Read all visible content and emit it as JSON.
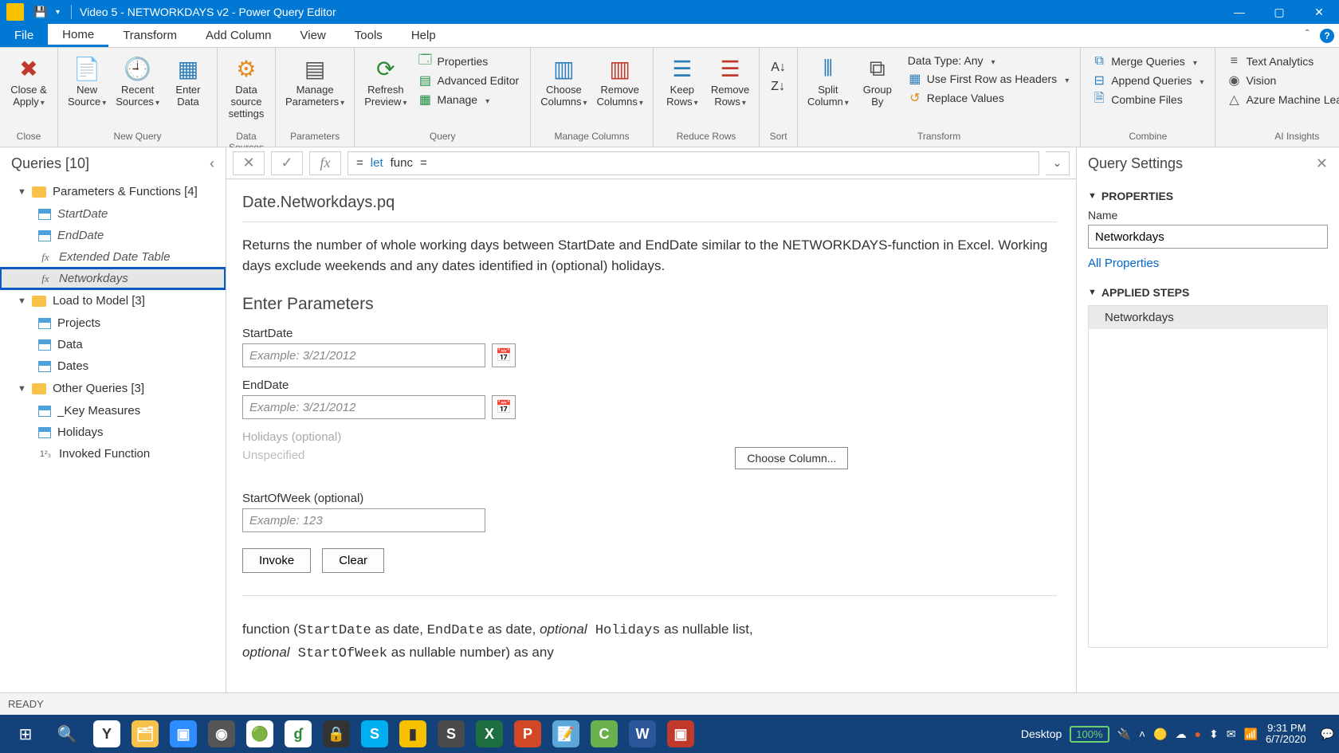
{
  "titlebar": {
    "title": "Video 5 - NETWORKDAYS v2 - Power Query Editor"
  },
  "menu": {
    "file": "File",
    "tabs": [
      "Home",
      "Transform",
      "Add Column",
      "View",
      "Tools",
      "Help"
    ],
    "active": 0
  },
  "ribbon": {
    "close": {
      "label": "Close &\nApply",
      "group": "Close"
    },
    "newquery": {
      "new_source": "New\nSource",
      "recent": "Recent\nSources",
      "enter": "Enter\nData",
      "group": "New Query"
    },
    "datasources": {
      "settings": "Data source\nsettings",
      "group": "Data Sources"
    },
    "parameters": {
      "manage": "Manage\nParameters",
      "group": "Parameters"
    },
    "query": {
      "refresh": "Refresh\nPreview",
      "properties": "Properties",
      "adv": "Advanced Editor",
      "manage": "Manage",
      "group": "Query"
    },
    "managecols": {
      "choose": "Choose\nColumns",
      "remove": "Remove\nColumns",
      "group": "Manage Columns"
    },
    "reducerows": {
      "keep": "Keep\nRows",
      "remove": "Remove\nRows",
      "group": "Reduce Rows"
    },
    "sort": {
      "group": "Sort"
    },
    "transform": {
      "split": "Split\nColumn",
      "group_by": "Group\nBy",
      "datatype": "Data Type: Any",
      "firstrow": "Use First Row as Headers",
      "replace": "Replace Values",
      "group": "Transform"
    },
    "combine": {
      "merge": "Merge Queries",
      "append": "Append Queries",
      "combine": "Combine Files",
      "group": "Combine"
    },
    "ai": {
      "text": "Text Analytics",
      "vision": "Vision",
      "aml": "Azure Machine Learning",
      "group": "AI Insights"
    }
  },
  "queries": {
    "header": "Queries [10]",
    "folders": [
      {
        "name": "Parameters & Functions [4]",
        "items": [
          {
            "label": "StartDate",
            "icon": "table",
            "italic": true
          },
          {
            "label": "EndDate",
            "icon": "table",
            "italic": true
          },
          {
            "label": "Extended Date Table",
            "icon": "fx",
            "italic": true
          },
          {
            "label": "Networkdays",
            "icon": "fx",
            "italic": true,
            "selected": true,
            "highlight": true
          }
        ]
      },
      {
        "name": "Load to Model [3]",
        "items": [
          {
            "label": "Projects",
            "icon": "table"
          },
          {
            "label": "Data",
            "icon": "table"
          },
          {
            "label": "Dates",
            "icon": "table"
          }
        ]
      },
      {
        "name": "Other Queries [3]",
        "items": [
          {
            "label": "_Key Measures",
            "icon": "table"
          },
          {
            "label": "Holidays",
            "icon": "table"
          },
          {
            "label": "Invoked Function",
            "icon": "num"
          }
        ]
      }
    ]
  },
  "formula": {
    "eq": "=",
    "kw1": "let",
    "id": "func",
    "eq2": "="
  },
  "content": {
    "fn_title": "Date.Networkdays.pq",
    "desc": "Returns the number of whole working days between StartDate and EndDate similar to the NETWORKDAYS-function in Excel. Working days exclude weekends and any dates identified in (optional) holidays.",
    "enter_params": "Enter Parameters",
    "p1_label": "StartDate",
    "p1_placeholder": "Example: 3/21/2012",
    "p2_label": "EndDate",
    "p2_placeholder": "Example: 3/21/2012",
    "p3_label": "Holidays (optional)",
    "p3_unspec": "Unspecified",
    "choose_col": "Choose Column...",
    "p4_label": "StartOfWeek (optional)",
    "p4_placeholder": "Example: 123",
    "invoke": "Invoke",
    "clear": "Clear",
    "sig_pre_func": "function (",
    "sig_p1": "StartDate",
    "sig_p1_t": " as date, ",
    "sig_p2": "EndDate",
    "sig_p2_t": " as date, ",
    "sig_opt": "optional",
    "sig_p3": " Holidays",
    "sig_p3_t": " as nullable list, ",
    "sig_p4": " StartOfWeek",
    "sig_p4_t": " as nullable number) as any"
  },
  "settings": {
    "header": "Query Settings",
    "properties": "PROPERTIES",
    "name_label": "Name",
    "name_value": "Networkdays",
    "all_props": "All Properties",
    "applied": "APPLIED STEPS",
    "step1": "Networkdays"
  },
  "statusbar": {
    "ready": "READY"
  },
  "taskbar": {
    "desktop": "Desktop",
    "battery": "100%",
    "time": "9:31 PM",
    "date": "6/7/2020"
  }
}
